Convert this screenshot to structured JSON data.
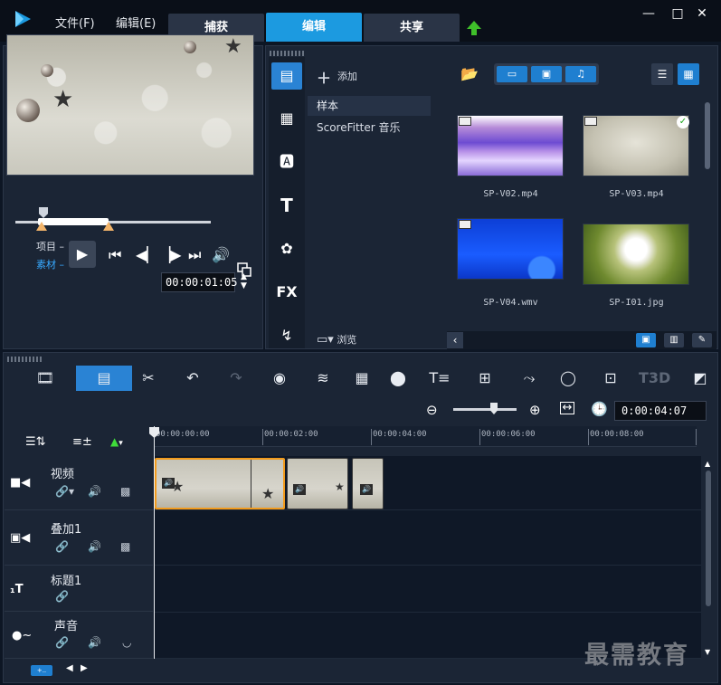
{
  "menu": {
    "file": "文件(F)",
    "edit": "编辑(E)"
  },
  "tabs": [
    {
      "label": "捕获",
      "active": false
    },
    {
      "label": "编辑",
      "active": true
    },
    {
      "label": "共享",
      "active": false
    }
  ],
  "window_controls": [
    "—",
    "□",
    "✕"
  ],
  "preview": {
    "label_project": "项目",
    "label_clip": "素材",
    "timecode": "00:00:01:05"
  },
  "library": {
    "add_label": "添加",
    "tree_items": [
      {
        "label": "样本",
        "selected": true
      },
      {
        "label": "ScoreFitter 音乐",
        "selected": false
      }
    ],
    "browse_label": "浏览",
    "filters": [
      "video",
      "photo",
      "audio"
    ],
    "media": [
      {
        "name": "SP-V02.mp4",
        "kind": "video",
        "checked": false
      },
      {
        "name": "SP-V03.mp4",
        "kind": "video",
        "checked": true
      },
      {
        "name": "SP-V04.wmv",
        "kind": "video",
        "checked": false
      },
      {
        "name": "SP-I01.jpg",
        "kind": "photo",
        "checked": false
      }
    ]
  },
  "timeline": {
    "timecode": "0:00:04:07",
    "ruler_ticks": [
      "00:00:00:00",
      "00:00:02:00",
      "00:00:04:00",
      "00:00:06:00",
      "00:00:08:00"
    ],
    "tracks": [
      {
        "name": "视频",
        "type": "video"
      },
      {
        "name": "叠加1",
        "type": "overlay"
      },
      {
        "name": "标题1",
        "type": "title"
      },
      {
        "name": "声音",
        "type": "voice"
      }
    ]
  },
  "watermark": "最需教育",
  "colors": {
    "accent": "#1c9ae0",
    "selection": "#f29b1c",
    "bg": "#0d1624"
  }
}
